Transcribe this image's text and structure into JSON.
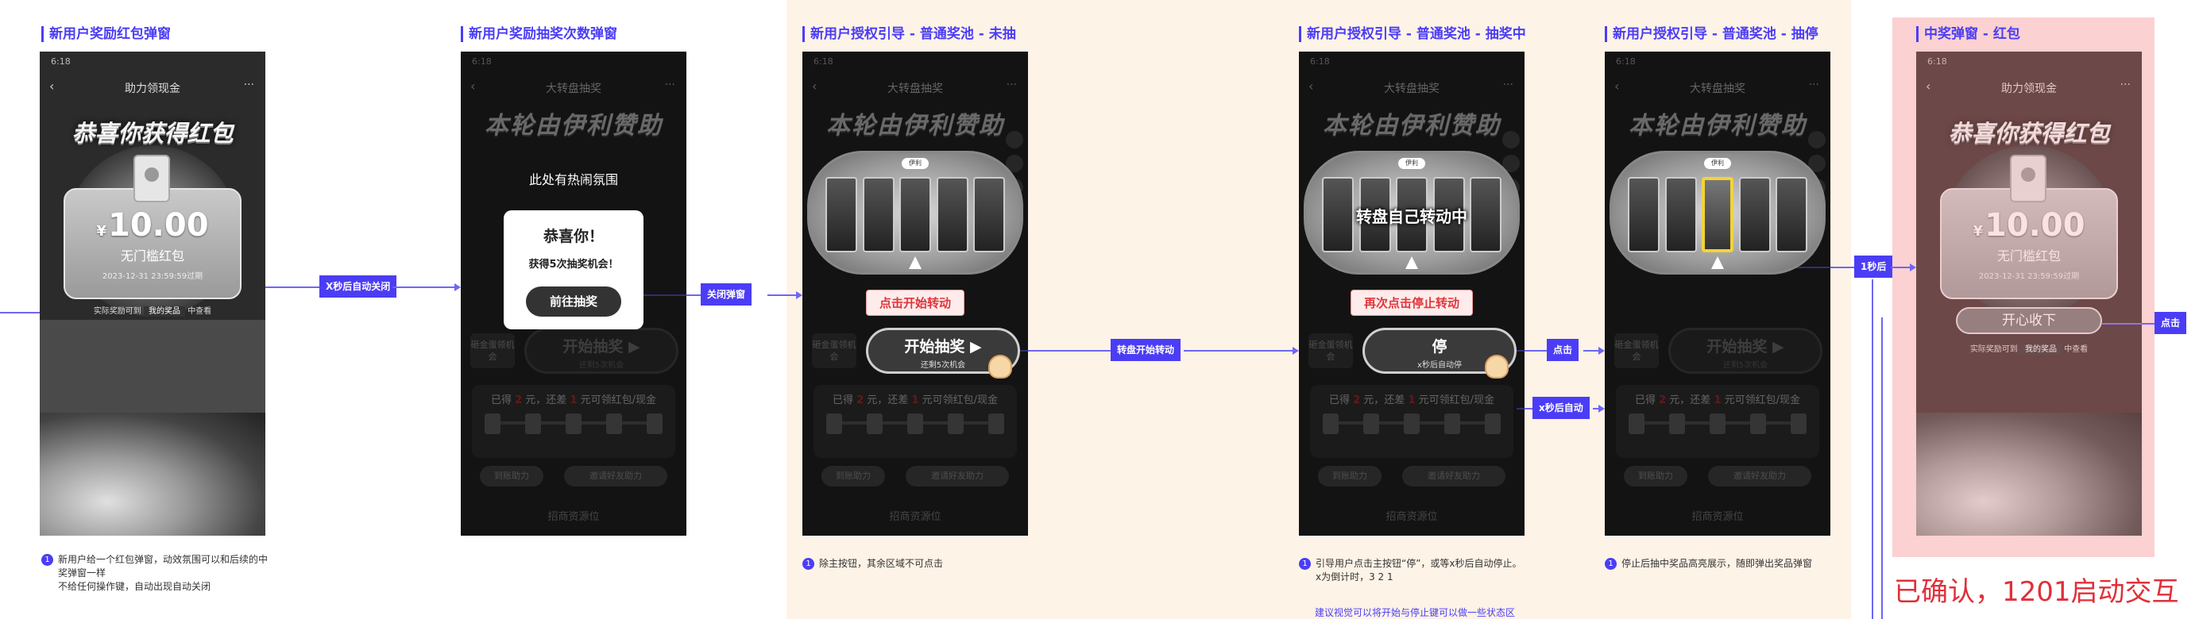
{
  "sections": [
    {
      "title": "新用户奖励红包弹窗"
    },
    {
      "title": "新用户奖励抽奖次数弹窗"
    },
    {
      "title": "新用户授权引导 - 普通奖池 - 未抽"
    },
    {
      "title": "新用户授权引导 - 普通奖池 - 抽奖中"
    },
    {
      "title": "新用户授权引导 - 普通奖池 - 抽停"
    },
    {
      "title": "中奖弹窗 - 红包"
    }
  ],
  "phone": {
    "status_time": "6:18",
    "page_title_redpacket": "助力领现金",
    "page_title_wheel": "大转盘抽奖",
    "banner": "本轮由伊利赞助",
    "wheel_logo": "伊利",
    "pre_button": "砸金蛋领机会",
    "progress_text_prefix": "已得",
    "progress_value_1": "2",
    "progress_text_mid": "元，还差",
    "progress_value_2": "1",
    "progress_text_suffix": "元可领红包/现金",
    "tab_left": "到账助力",
    "tab_right": "邀请好友助力",
    "bottom_text": "招商资源位"
  },
  "redpacket": {
    "header": "恭喜你获得红包",
    "currency": "¥",
    "amount": "10.00",
    "name": "无门槛红包",
    "expiry": "2023-12-31 23:59:59过期",
    "footer_prefix": "实际奖励可到",
    "footer_link": "我的奖品",
    "footer_suffix": "中查看",
    "accept_button": "开心收下"
  },
  "chance_modal": {
    "hot_text": "此处有热闹氛围",
    "title": "恭喜你！",
    "subtitle": "获得5次抽奖机会！",
    "button": "前往抽奖"
  },
  "buttons": {
    "start": "开始抽奖 ▶",
    "start_sub": "还剩5次机会",
    "stop": "停",
    "stop_sub": "x秒后自动停"
  },
  "hints": {
    "click_start": "点击开始转动",
    "click_stop": "再次点击停止转动",
    "wheel_spinning": "转盘自己转动中"
  },
  "tags": {
    "auto_close": "X秒后自动关闭",
    "close_popup": "关闭弹窗",
    "wheel_start": "转盘开始转动",
    "click": "点击",
    "auto_after": "x秒后自动",
    "one_second": "1秒后",
    "click2": "点击"
  },
  "notes": {
    "n1_num": "1",
    "n1_l1": "新用户给一个红包弹窗，动效氛围可以和后续的中",
    "n1_l2": "奖弹窗一样",
    "n1_l3": "不给任何操作键，自动出现自动关闭",
    "n2_num": "1",
    "n2": "除主按钮，其余区域不可点击",
    "n3_num": "1",
    "n3_l1": "引导用户点击主按钮“停”，或等x秒后自动停止。",
    "n3_l2": "x为倒计时，3 2 1",
    "n3_link": "建议视觉可以将开始与停止键可以做一些状态区",
    "n4_num": "1",
    "n4": "停止后抽中奖品高亮展示，随即弹出奖品弹窗",
    "confirmed": "已确认，1201启动交互"
  },
  "colors": {
    "accent": "#4b3df5",
    "peach_bg": "#fdf3e7",
    "pink_bg": "#fbd1d1",
    "alert_red": "#e0303a"
  }
}
